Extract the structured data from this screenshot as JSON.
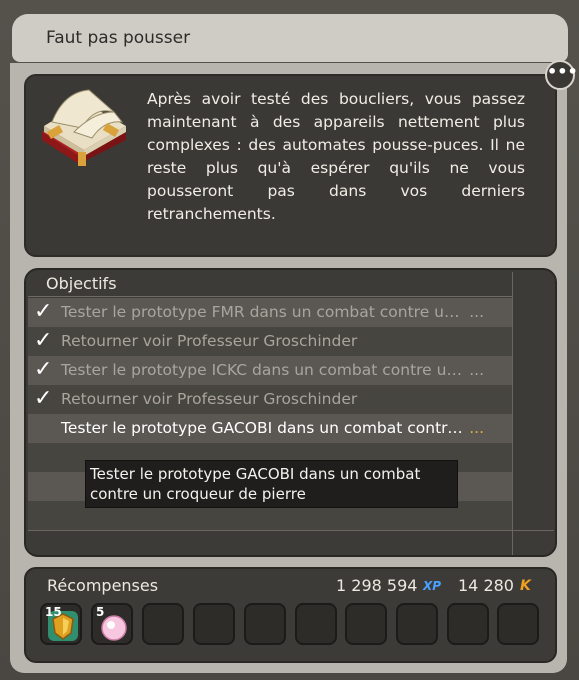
{
  "window": {
    "title": "Faut pas pousser"
  },
  "description": {
    "text": "Après avoir testé des boucliers, vous passez maintenant à des appareils nettement plus complexes : des automates pousse-puces. Il ne reste plus qu'à espérer qu'ils ne vous pousseront pas dans vos derniers retranchements."
  },
  "objectives": {
    "header": "Objectifs",
    "items": [
      {
        "label": "Tester le prototype FMR dans un combat contre un croqueur de pierre",
        "done": true
      },
      {
        "label": "Retourner voir Professeur Groschinder",
        "done": true
      },
      {
        "label": "Tester le prototype ICKC dans un combat contre un croqueur de pierre",
        "done": true
      },
      {
        "label": "Retourner voir Professeur Groschinder",
        "done": true
      },
      {
        "label": "Tester le prototype GACOBI dans un combat contre un croqueur de pierre",
        "done": false
      }
    ],
    "ellipsis": "...",
    "tooltip": "Tester le prototype GACOBI dans un combat contre un croqueur de pierre"
  },
  "rewards": {
    "title": "Récompenses",
    "xp": "1 298 594",
    "xp_tag": "XP",
    "kamas": "14 280",
    "kamas_tag": "K",
    "items": [
      {
        "count": "15",
        "icon": "shield-item-icon"
      },
      {
        "count": "5",
        "icon": "pink-orb-icon"
      }
    ]
  },
  "icons": {
    "chat": "chat-bubble-icon",
    "book": "open-book-icon",
    "check": "checkmark-icon"
  }
}
